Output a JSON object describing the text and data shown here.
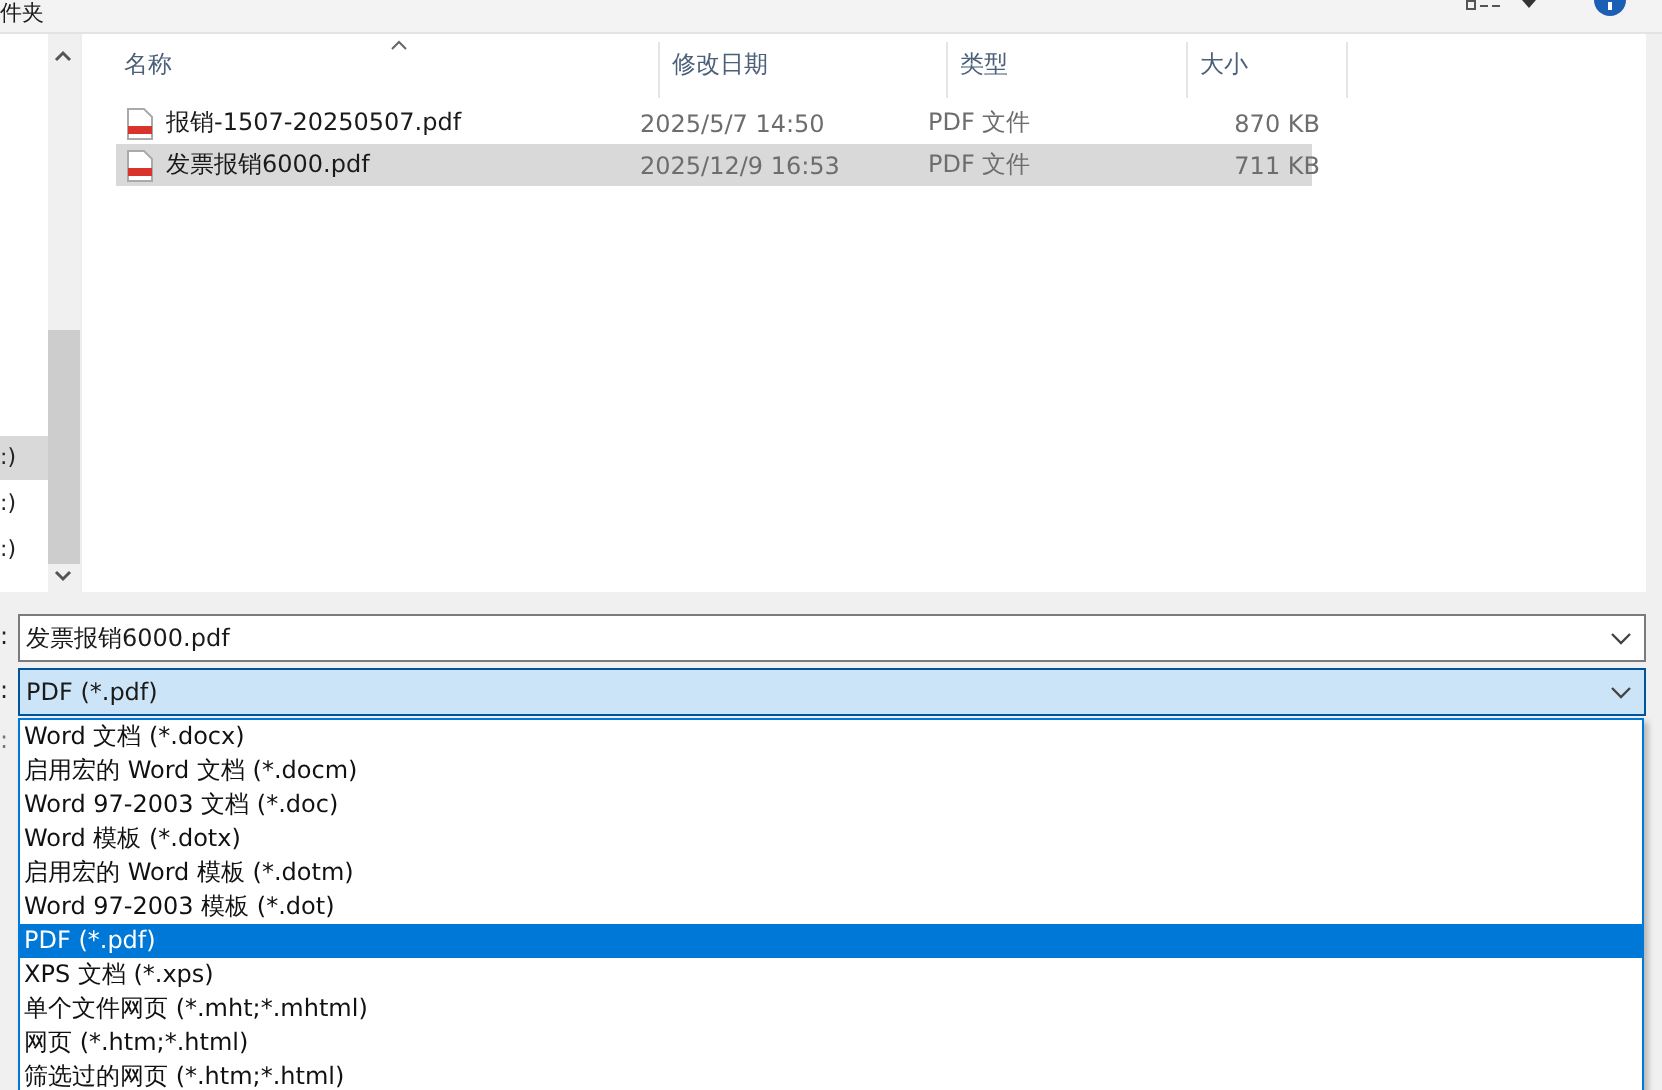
{
  "top_bar": {
    "title": "件夹"
  },
  "nav_pane": {
    "items": [
      {
        "label": ":)",
        "selected": true
      },
      {
        "label": ":)",
        "selected": false
      },
      {
        "label": ":)",
        "selected": false
      }
    ]
  },
  "file_list": {
    "columns": [
      "名称",
      "修改日期",
      "类型",
      "大小"
    ],
    "rows": [
      {
        "name": "报销-1507-20250507.pdf",
        "modified": "2025/5/7 14:50",
        "type": "PDF 文件",
        "size": "870 KB",
        "selected": false
      },
      {
        "name": "发票报销6000.pdf",
        "modified": "2025/12/9 16:53",
        "type": "PDF 文件",
        "size": "711 KB",
        "selected": true
      }
    ]
  },
  "form": {
    "file_name_label": ":",
    "file_name": "发票报销6000.pdf",
    "file_type_label": ":",
    "file_type": "PDF (*.pdf)",
    "side_labels": [
      ":"
    ],
    "type_options": [
      {
        "label": "Word 文档 (*.docx)",
        "selected": false
      },
      {
        "label": "启用宏的 Word 文档 (*.docm)",
        "selected": false
      },
      {
        "label": "Word 97-2003 文档 (*.doc)",
        "selected": false
      },
      {
        "label": "Word 模板 (*.dotx)",
        "selected": false
      },
      {
        "label": "启用宏的 Word 模板 (*.dotm)",
        "selected": false
      },
      {
        "label": "Word 97-2003 模板 (*.dot)",
        "selected": false
      },
      {
        "label": "PDF (*.pdf)",
        "selected": true
      },
      {
        "label": "XPS 文档 (*.xps)",
        "selected": false
      },
      {
        "label": "单个文件网页 (*.mht;*.mhtml)",
        "selected": false
      },
      {
        "label": "网页 (*.htm;*.html)",
        "selected": false
      },
      {
        "label": "筛选过的网页 (*.htm;*.html)",
        "selected": false
      }
    ]
  }
}
